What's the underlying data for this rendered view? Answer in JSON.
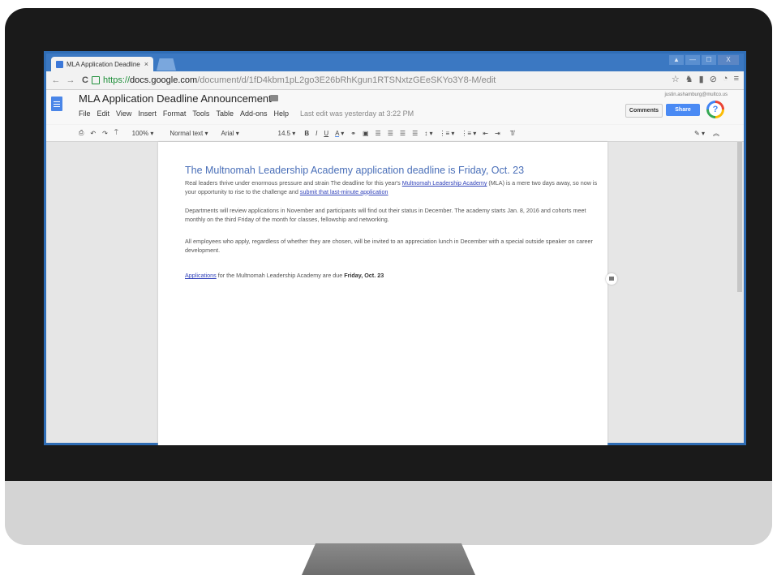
{
  "browser": {
    "tab_title": "MLA Application Deadline",
    "tab_close": "×",
    "url_scheme": "https://",
    "url_host": "docs.google.com",
    "url_path": "/document/d/1fD4kbm1pL2go3E26bRhKgun1RTSNxtzGEeSKYo3Y8-M/edit",
    "window_controls": [
      "▲",
      "—",
      "☐",
      "X"
    ],
    "nav": {
      "back": "←",
      "forward": "→",
      "reload": "C"
    },
    "icons": [
      "star-icon",
      "extension-icon",
      "media-icon",
      "block-icon",
      "sync-icon",
      "menu-icon"
    ]
  },
  "docs": {
    "title": "MLA Application Deadline Announcement",
    "menu": [
      "File",
      "Edit",
      "View",
      "Insert",
      "Format",
      "Tools",
      "Table",
      "Add-ons",
      "Help"
    ],
    "last_edit": "Last edit was yesterday at 3:22 PM",
    "user_email": "justin.ashamburg@multco.us",
    "comments_label": "Comments",
    "share_label": "Share",
    "help_label": "?",
    "toolbar": {
      "zoom": "100%",
      "style": "Normal text",
      "font": "Arial",
      "size": "14.5"
    }
  },
  "document": {
    "heading": "The Multnomah Leadership Academy application deadline is Friday, Oct. 23",
    "p1_pre": "Real leaders thrive under enormous pressure and strain The deadline for this year's ",
    "p1_link": "Multnomah Leadership Academy",
    "p1_mid": " (MLA) is a mere two days away, so now is your opportunity to rise to the challenge and ",
    "p1_link2": "submit that last-minute application",
    "p2": "Departments will review applications in November and participants will find out their status in December. The academy starts Jan. 8, 2016 and cohorts meet monthly on the third Friday of the month for classes, fellowship and networking.",
    "p3": "All employees who apply, regardless of whether they are chosen, will be invited to an appreciation lunch in December with a special outside speaker on career development.",
    "p4_link": "Applications",
    "p4_mid": " for the Multnomah Leadership Academy are due ",
    "p4_bold": "Friday, Oct. 23"
  },
  "colors": {
    "accent": "#4a86e8",
    "chrome_frame": "#3b78c2",
    "heading": "#4a6fb8"
  }
}
